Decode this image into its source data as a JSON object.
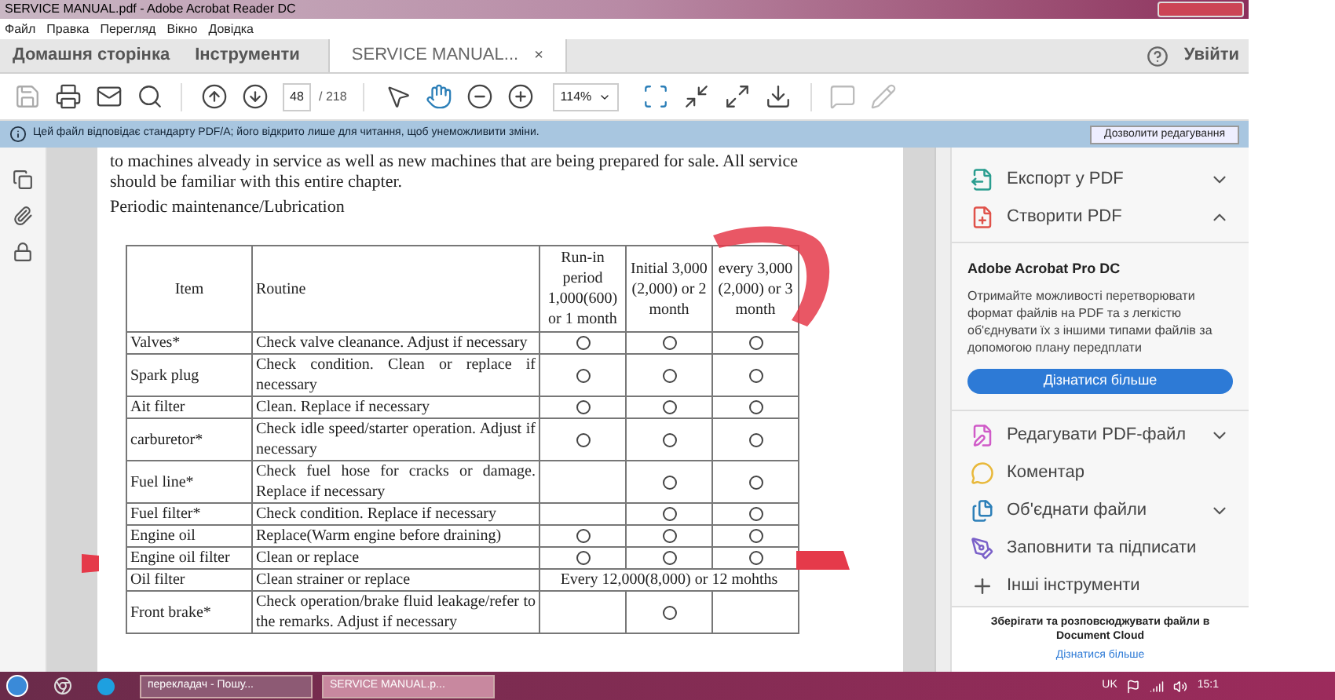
{
  "window": {
    "title": "SERVICE MANUAL.pdf - Adobe Acrobat Reader DC"
  },
  "menu": [
    "Файл",
    "Правка",
    "Перегляд",
    "Вікно",
    "Довідка"
  ],
  "tabs": [
    {
      "label": "Домашня сторінка",
      "selected": false
    },
    {
      "label": "Інструменти",
      "selected": false
    },
    {
      "label": "SERVICE MANUAL...",
      "selected": true,
      "close": "×"
    }
  ],
  "sign_in": "Увійти",
  "toolbar": {
    "page": "48",
    "page_total": "/ 218",
    "zoom": "114%"
  },
  "info_bar": {
    "message": "Цей файл відповідає стандарту PDF/A; його відкрито лише для читання, щоб унеможливити зміни.",
    "button": "Дозволити редагування"
  },
  "document": {
    "paragraph": "to machines alveady in service as well as new machines that are being prepared for sale. All service should be familiar with this entire chapter.",
    "heading": "Periodic maintenance/Lubrication",
    "table": {
      "columns": [
        "Item",
        "Routine",
        "Run-in period 1,000(600) or 1 month",
        "Initial 3,000 (2,000) or 2 month",
        "every 3,000 (2,000) or 3 month"
      ],
      "rows": [
        {
          "item": "Valves*",
          "routine": "Check valve cleanance. Adjust if necessary",
          "marks": [
            true,
            true,
            true
          ]
        },
        {
          "item": "Spark plug",
          "routine": "Check condition. Clean or replace if necessary",
          "marks": [
            true,
            true,
            true
          ]
        },
        {
          "item": "Ait filter",
          "routine": "Clean. Replace if necessary",
          "marks": [
            true,
            true,
            true
          ]
        },
        {
          "item": "carburetor*",
          "routine": "Check idle speed/starter operation. Adjust if necessary",
          "marks": [
            true,
            true,
            true
          ]
        },
        {
          "item": "Fuel line*",
          "routine": "Check fuel hose for cracks or damage. Replace if necessary",
          "marks": [
            false,
            true,
            true
          ]
        },
        {
          "item": "Fuel filter*",
          "routine": "Check condition. Replace if necessary",
          "marks": [
            false,
            true,
            true
          ]
        },
        {
          "item": "Engine oil",
          "routine": "Replace(Warm engine before draining)",
          "marks": [
            true,
            true,
            true
          ]
        },
        {
          "item": "Engine oil filter",
          "routine": "Clean or replace",
          "marks": [
            true,
            true,
            true
          ]
        },
        {
          "item": "Oil filter",
          "routine": "Clean strainer or replace",
          "interval": "Every 12,000(8,000) or 12 mohths"
        },
        {
          "item": "Front brake*",
          "routine": "Check operation/brake fluid leakage/refer to the remarks. Adjust if necessary",
          "marks": [
            false,
            true,
            false
          ]
        }
      ]
    }
  },
  "tools_pane": {
    "top_items": [
      {
        "label": "Експорт у PDF",
        "expanded": false
      },
      {
        "label": "Створити PDF",
        "expanded": true
      }
    ],
    "promo": {
      "title": "Adobe Acrobat Pro DC",
      "text": "Отримайте можливості перетворювати формат файлів на PDF та з легкістю об'єднувати їх з іншими типами файлів за допомогою плану передплати",
      "button": "Дізнатися більше"
    },
    "items": [
      {
        "label": "Редагувати PDF-файл",
        "expanded": false
      },
      {
        "label": "Коментар"
      },
      {
        "label": "Об'єднати файли",
        "expanded": false
      },
      {
        "label": "Заповнити та підписати"
      },
      {
        "label": "Інші інструменти"
      }
    ],
    "cloud": {
      "text": "Зберігати та розповсюджувати файли в Document Cloud",
      "link": "Дізнатися більше"
    }
  },
  "taskbar": {
    "tasks": [
      {
        "label": "перекладач - Пошу...",
        "selected": false
      },
      {
        "label": "SERVICE MANUAL.p...",
        "selected": true
      }
    ],
    "language": "UK",
    "clock": "15:1"
  }
}
